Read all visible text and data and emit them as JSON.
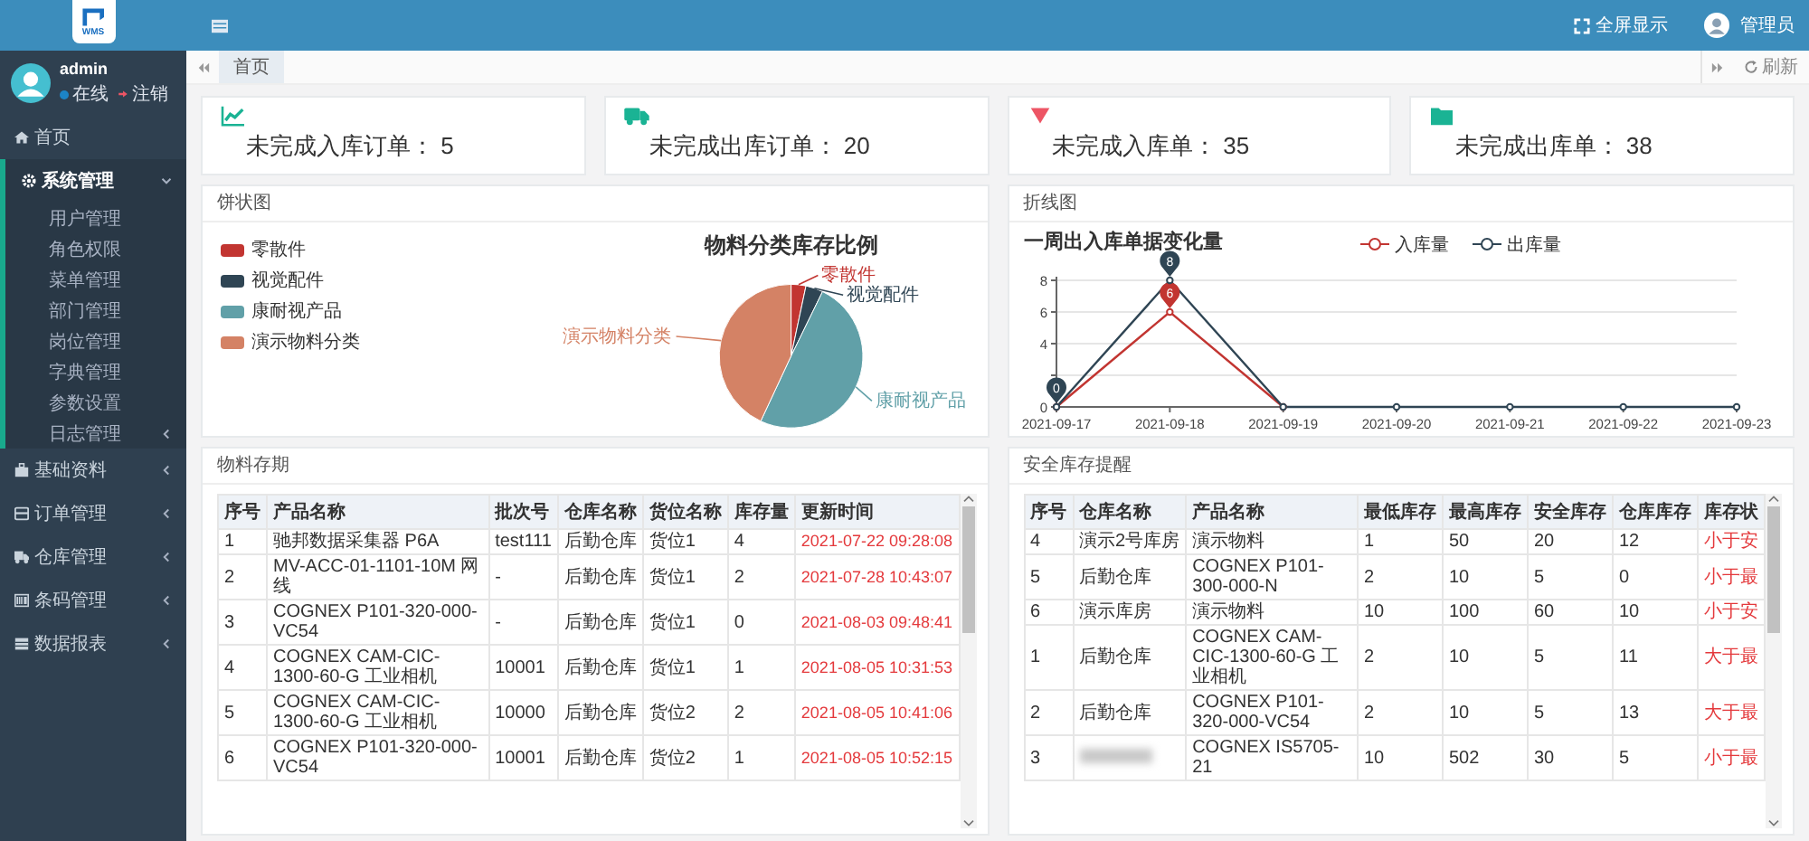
{
  "sidebar": {
    "logo_text": "WMS",
    "user": {
      "name": "admin",
      "status": "在线",
      "logout": "注销"
    },
    "menu": [
      {
        "label": "首页"
      },
      {
        "label": "系统管理",
        "expanded": true,
        "children": [
          {
            "label": "用户管理"
          },
          {
            "label": "角色权限"
          },
          {
            "label": "菜单管理"
          },
          {
            "label": "部门管理"
          },
          {
            "label": "岗位管理"
          },
          {
            "label": "字典管理"
          },
          {
            "label": "参数设置"
          },
          {
            "label": "日志管理",
            "expanded": false
          }
        ]
      },
      {
        "label": "基础资料",
        "expanded": false
      },
      {
        "label": "订单管理",
        "expanded": false
      },
      {
        "label": "仓库管理",
        "expanded": false
      },
      {
        "label": "条码管理",
        "expanded": false
      },
      {
        "label": "数据报表",
        "expanded": false
      }
    ]
  },
  "topbar": {
    "fullscreen": "全屏显示",
    "user": "管理员"
  },
  "tabs": [
    {
      "label": "首页",
      "selected": true
    }
  ],
  "refresh": "刷新",
  "stats": [
    {
      "text": "未完成入库订单： 5"
    },
    {
      "text": "未完成出库订单： 20"
    },
    {
      "text": "未完成入库单： 35"
    },
    {
      "text": "未完成出库单： 38"
    }
  ],
  "pie_panel": {
    "title": "饼状图",
    "chart_title": "物料分类库存比例",
    "legend": [
      {
        "name": "零散件",
        "color": "#c23531"
      },
      {
        "name": "视觉配件",
        "color": "#2f4554"
      },
      {
        "name": "康耐视产品",
        "color": "#61a0a8"
      },
      {
        "name": "演示物料分类",
        "color": "#d48265"
      }
    ],
    "slice_labels": [
      "零散件",
      "视觉配件",
      "康耐视产品",
      "演示物料分类"
    ]
  },
  "line_panel": {
    "title": "折线图",
    "chart_data": {
      "type": "line",
      "title": "一周出入库单据变化量",
      "legend": "top",
      "categories": [
        "2021-09-17",
        "2021-09-18",
        "2021-09-19",
        "2021-09-20",
        "2021-09-21",
        "2021-09-22",
        "2021-09-23"
      ],
      "series": [
        {
          "name": "入库量",
          "color": "#c23531",
          "marker": "circle",
          "values": [
            0,
            6,
            0,
            null,
            null,
            null,
            null
          ]
        },
        {
          "name": "出库量",
          "color": "#2f4554",
          "marker": "circle",
          "values": [
            0,
            8,
            0,
            0,
            0,
            0,
            0
          ]
        }
      ],
      "ylim": [
        0,
        8
      ],
      "yticks": [
        0,
        4,
        6,
        8
      ],
      "annotations": [
        {
          "x": "2021-09-18",
          "y": 8,
          "text": "8"
        },
        {
          "x": "2021-09-18",
          "y": 6,
          "text": "6"
        },
        {
          "x": "2021-09-17",
          "y": 0,
          "text": "0"
        }
      ]
    }
  },
  "stock_panel": {
    "title": "物料存期",
    "columns": [
      "序号",
      "产品名称",
      "批次号",
      "仓库名称",
      "货位名称",
      "库存量",
      "更新时间"
    ],
    "rows": [
      [
        "1",
        "驰邦数据采集器 P6A",
        "test111",
        "后勤仓库",
        "货位1",
        "4",
        "2021-07-22 09:28:08"
      ],
      [
        "2",
        "MV-ACC-01-1101-10M 网线",
        "-",
        "后勤仓库",
        "货位1",
        "2",
        "2021-07-28 10:43:07"
      ],
      [
        "3",
        "COGNEX P101-320-000-VC54",
        "-",
        "后勤仓库",
        "货位1",
        "0",
        "2021-08-03 09:48:41"
      ],
      [
        "4",
        "COGNEX CAM-CIC-1300-60-G 工业相机",
        "10001",
        "后勤仓库",
        "货位1",
        "1",
        "2021-08-05 10:31:53"
      ],
      [
        "5",
        "COGNEX CAM-CIC-1300-60-G 工业相机",
        "10000",
        "后勤仓库",
        "货位2",
        "2",
        "2021-08-05 10:41:06"
      ],
      [
        "6",
        "COGNEX P101-320-000-VC54",
        "10001",
        "后勤仓库",
        "货位2",
        "1",
        "2021-08-05 10:52:15"
      ]
    ]
  },
  "safety_panel": {
    "title": "安全库存提醒",
    "columns": [
      "序号",
      "仓库名称",
      "产品名称",
      "最低库存",
      "最高库存",
      "安全库存",
      "仓库库存",
      "库存状"
    ],
    "rows": [
      [
        "4",
        "演示2号库房",
        "演示物料",
        "1",
        "50",
        "20",
        "12",
        "小于安"
      ],
      [
        "5",
        "后勤仓库",
        "COGNEX P101-300-000-N",
        "2",
        "10",
        "5",
        "0",
        "小于最"
      ],
      [
        "6",
        "演示库房",
        "演示物料",
        "10",
        "100",
        "60",
        "10",
        "小于安"
      ],
      [
        "1",
        "后勤仓库",
        "COGNEX CAM-CIC-1300-60-G 工业相机",
        "2",
        "10",
        "5",
        "11",
        "大于最"
      ],
      [
        "2",
        "后勤仓库",
        "COGNEX P101-320-000-VC54",
        "2",
        "10",
        "5",
        "13",
        "大于最"
      ],
      [
        "3",
        null,
        "COGNEX IS5705-21",
        "10",
        "502",
        "30",
        "5",
        "小于最"
      ]
    ]
  }
}
